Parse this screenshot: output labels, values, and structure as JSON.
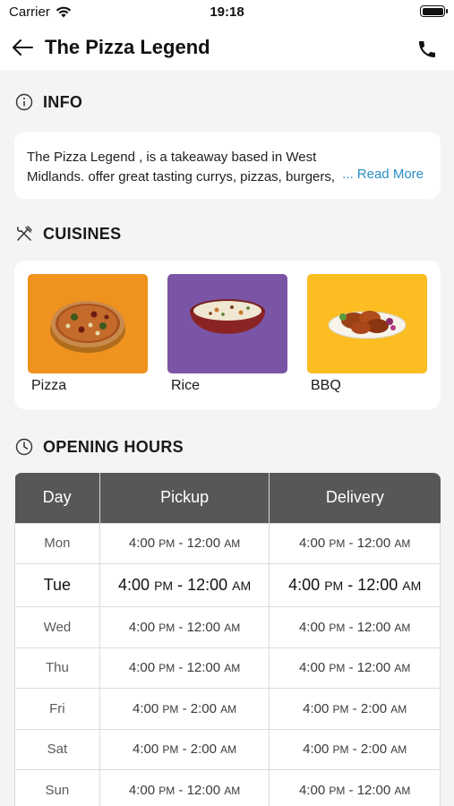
{
  "status_bar": {
    "carrier": "Carrier",
    "time": "19:18"
  },
  "nav": {
    "title": "The Pizza Legend",
    "back_icon": "arrow-left-icon",
    "call_icon": "phone-icon"
  },
  "info": {
    "heading": "INFO",
    "text": "The Pizza Legend , is a takeaway based in West Midlands. offer great tasting currys, pizzas, burgers, Kebabs and Sides",
    "read_more": "... Read More"
  },
  "cuisines": {
    "heading": "CUISINES",
    "items": [
      {
        "name": "Pizza",
        "bg": "#f0921e"
      },
      {
        "name": "Rice",
        "bg": "#7b55a5"
      },
      {
        "name": "BBQ",
        "bg": "#fbbd21"
      }
    ]
  },
  "opening_hours": {
    "heading": "OPENING HOURS",
    "columns": [
      "Day",
      "Pickup",
      "Delivery"
    ],
    "rows": [
      {
        "day": "Mon",
        "pickup": {
          "open": "4:00",
          "open_ampm": "PM",
          "close": "12:00",
          "close_ampm": "AM"
        },
        "delivery": {
          "open": "4:00",
          "open_ampm": "PM",
          "close": "12:00",
          "close_ampm": "AM"
        }
      },
      {
        "day": "Tue",
        "pickup": {
          "open": "4:00",
          "open_ampm": "PM",
          "close": "12:00",
          "close_ampm": "AM"
        },
        "delivery": {
          "open": "4:00",
          "open_ampm": "PM",
          "close": "12:00",
          "close_ampm": "AM"
        }
      },
      {
        "day": "Wed",
        "pickup": {
          "open": "4:00",
          "open_ampm": "PM",
          "close": "12:00",
          "close_ampm": "AM"
        },
        "delivery": {
          "open": "4:00",
          "open_ampm": "PM",
          "close": "12:00",
          "close_ampm": "AM"
        }
      },
      {
        "day": "Thu",
        "pickup": {
          "open": "4:00",
          "open_ampm": "PM",
          "close": "12:00",
          "close_ampm": "AM"
        },
        "delivery": {
          "open": "4:00",
          "open_ampm": "PM",
          "close": "12:00",
          "close_ampm": "AM"
        }
      },
      {
        "day": "Fri",
        "pickup": {
          "open": "4:00",
          "open_ampm": "PM",
          "close": "2:00",
          "close_ampm": "AM"
        },
        "delivery": {
          "open": "4:00",
          "open_ampm": "PM",
          "close": "2:00",
          "close_ampm": "AM"
        }
      },
      {
        "day": "Sat",
        "pickup": {
          "open": "4:00",
          "open_ampm": "PM",
          "close": "2:00",
          "close_ampm": "AM"
        },
        "delivery": {
          "open": "4:00",
          "open_ampm": "PM",
          "close": "2:00",
          "close_ampm": "AM"
        }
      },
      {
        "day": "Sun",
        "pickup": {
          "open": "4:00",
          "open_ampm": "PM",
          "close": "12:00",
          "close_ampm": "AM"
        },
        "delivery": {
          "open": "4:00",
          "open_ampm": "PM",
          "close": "12:00",
          "close_ampm": "AM"
        }
      }
    ]
  },
  "colors": {
    "accent_link": "#2a8fc7",
    "table_header": "#575757",
    "page_bg": "#f4f4f5"
  }
}
